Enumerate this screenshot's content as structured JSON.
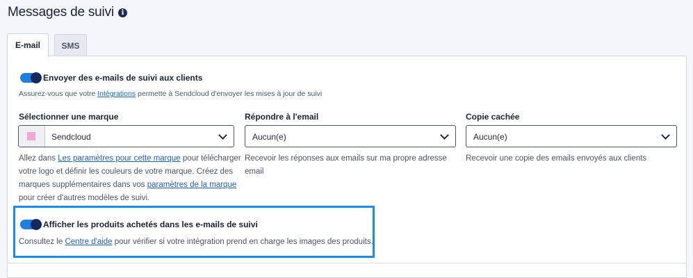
{
  "header": {
    "title": "Messages de suivi",
    "info_icon": "info-icon"
  },
  "tabs": [
    {
      "label": "E-mail",
      "active": true
    },
    {
      "label": "SMS",
      "active": false
    }
  ],
  "email_toggle": {
    "label": "Envoyer des e-mails de suivi aux clients",
    "on": true,
    "desc_before": "Assurez-vous que votre ",
    "desc_link": "Intégrations",
    "desc_after": " permette à Sendcloud d'envoyer les mises à jour de suivi"
  },
  "brand": {
    "label": "Sélectionner une marque",
    "value": "Sendcloud",
    "swatch_color": "#f3a6d6",
    "help_1": "Allez dans ",
    "help_link_1": "Les paramètres pour cette marque",
    "help_2": " pour télécharger",
    "help_3": "votre logo et définir les couleurs de votre marque. Créez des",
    "help_4": "marques supplémentaires dans vos ",
    "help_link_2": "paramètres de la marque",
    "help_5": "pour créer d'autres modèles de suivi."
  },
  "reply": {
    "label": "Répondre à l'email",
    "value": "Aucun(e)",
    "help_1": "Recevoir les réponses aux emails sur ma propre adresse",
    "help_2": "email"
  },
  "bcc": {
    "label": "Copie cachée",
    "value": "Aucun(e)",
    "help": "Recevoir une copie des emails envoyés aux clients"
  },
  "products_toggle": {
    "label": "Afficher les produits achetés dans les e-mails de suivi",
    "on": true,
    "desc_before": "Consultez le ",
    "desc_link": "Centre d'aide",
    "desc_after": " pour vérifier si votre intégration prend en charge les images des produits."
  },
  "colors": {
    "accent": "#1f7fe0",
    "highlight": "#1a8cf0",
    "link": "#1f5fb8"
  }
}
